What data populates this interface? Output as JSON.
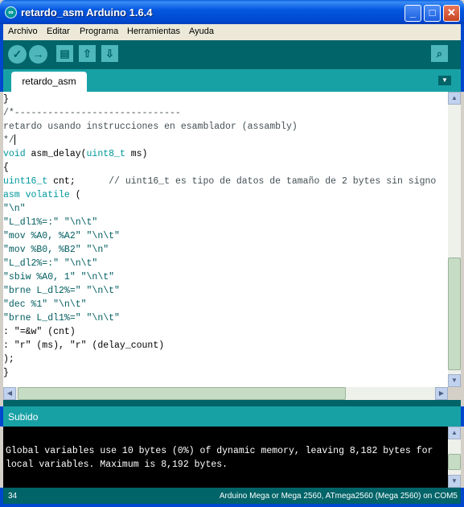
{
  "window": {
    "title": "retardo_asm Arduino 1.6.4",
    "minimize": "_",
    "maximize": "□",
    "close": "✕"
  },
  "menu": [
    "Archivo",
    "Editar",
    "Programa",
    "Herramientas",
    "Ayuda"
  ],
  "toolbar": {
    "verify_icon": "check-icon",
    "upload_icon": "arrow-right-icon",
    "new_icon": "file-icon",
    "open_icon": "arrow-up-icon",
    "save_icon": "arrow-down-icon",
    "monitor_icon": "magnifier-icon"
  },
  "tabs": [
    {
      "label": "retardo_asm"
    }
  ],
  "editor": {
    "lines": [
      "}",
      "/*------------------------------",
      "retardo usando instrucciones en esamblador (assambly)",
      "*/",
      "void asm_delay(uint8_t ms)",
      "{",
      "uint16_t cnt;      // uint16_t es tipo de datos de tamaño de 2 bytes sin signo",
      "asm volatile (",
      "\"\\n\"",
      "\"L_dl1%=:\" \"\\n\\t\"",
      "\"mov %A0, %A2\" \"\\n\\t\"",
      "\"mov %B0, %B2\" \"\\n\"",
      "\"L_dl2%=:\" \"\\n\\t\"",
      "\"sbiw %A0, 1\" \"\\n\\t\"",
      "\"brne L_dl2%=\" \"\\n\\t\"",
      "\"dec %1\" \"\\n\\t\"",
      "\"brne L_dl1%=\" \"\\n\\t\"",
      ": \"=&w\" (cnt)",
      ": \"r\" (ms), \"r\" (delay_count)",
      ");",
      "}"
    ]
  },
  "status": {
    "message": "Subido"
  },
  "console": {
    "lines": [
      "Global variables use 10 bytes (0%) of dynamic memory, leaving 8,182 bytes for",
      "local variables. Maximum is 8,192 bytes."
    ]
  },
  "footer": {
    "line_number": "34",
    "board": "Arduino Mega or Mega 2560, ATmega2560 (Mega 2560) on COM5"
  },
  "colors": {
    "teal_dark": "#006468",
    "teal_light": "#17a1a5",
    "keyword": "#00979c",
    "comment": "#434f54"
  }
}
